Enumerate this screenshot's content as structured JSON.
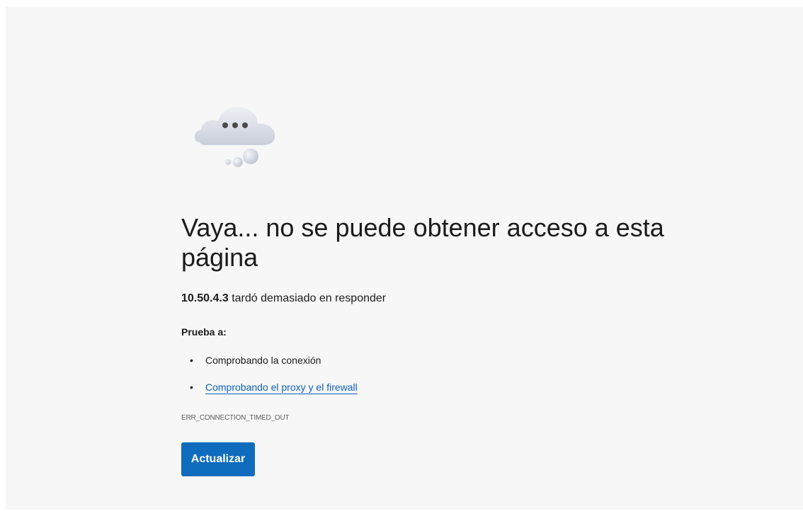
{
  "error": {
    "icon": "cloud-dots-icon",
    "title": "Vaya... no se puede obtener acceso a esta página",
    "host": "10.50.4.3",
    "message": "tardó demasiado en responder",
    "try_label": "Prueba a:",
    "suggestions": [
      {
        "label": "Comprobando la conexión",
        "link": false
      },
      {
        "label": "Comprobando el proxy y el firewall",
        "link": true
      }
    ],
    "code": "ERR_CONNECTION_TIMED_OUT",
    "refresh_label": "Actualizar"
  },
  "colors": {
    "background": "#f7f7f7",
    "text": "#1b1b1b",
    "link": "#0f5fb8",
    "button": "#0f6cbd"
  }
}
